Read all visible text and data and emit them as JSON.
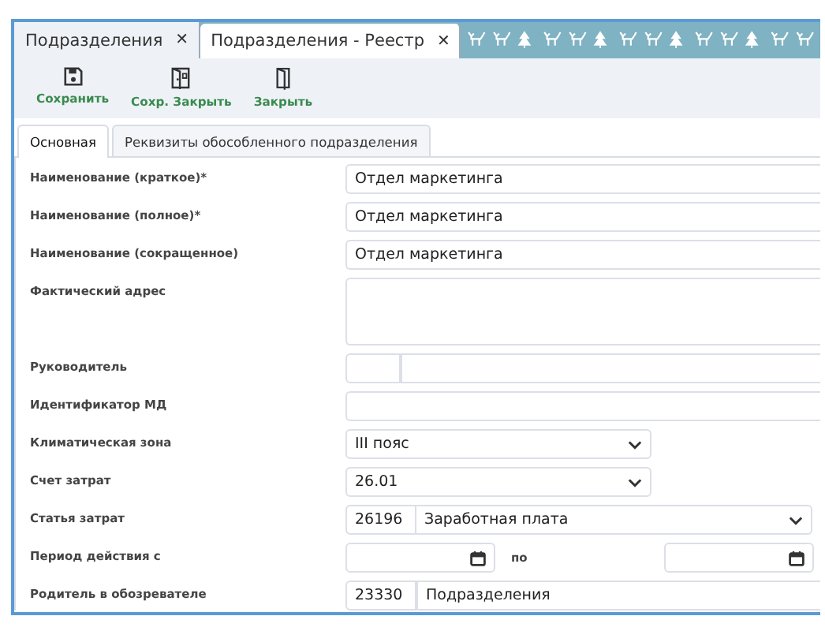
{
  "doc_tabs": [
    {
      "label": "Подразделения",
      "close": "✕",
      "selected": true
    },
    {
      "label": "Подразделения - Реестр",
      "close": "✕",
      "selected": false
    }
  ],
  "toolbar": [
    {
      "kind": "save",
      "label": "Сохранить"
    },
    {
      "kind": "save_close",
      "label": "Сохр. Закрыть"
    },
    {
      "kind": "close",
      "label": "Закрыть"
    }
  ],
  "form_tabs": [
    {
      "label": "Основная",
      "selected": true
    },
    {
      "label": "Реквизиты обособленного подразделения",
      "selected": false
    }
  ],
  "fields": [
    {
      "kind": "text",
      "label": "Наименование (краткое)*",
      "value": "Отдел маркетинга"
    },
    {
      "kind": "text",
      "label": "Наименование (полное)*",
      "value": "Отдел маркетинга"
    },
    {
      "kind": "text",
      "label": "Наименование (сокращенное)",
      "value": "Отдел маркетинга"
    },
    {
      "kind": "textarea",
      "label": "Фактический адрес"
    },
    {
      "kind": "lookup",
      "label": "Руководитель"
    },
    {
      "kind": "text",
      "label": "Идентификатор МД"
    },
    {
      "kind": "select",
      "label": "Климатическая зона",
      "value": "III пояс"
    },
    {
      "kind": "select",
      "label": "Счет затрат",
      "value": "26.01"
    },
    {
      "kind": "code_select",
      "label": "Статья затрат",
      "code": "26196",
      "value": "Заработная плата"
    },
    {
      "kind": "period",
      "label": "Период действия с",
      "to_label": "по"
    },
    {
      "kind": "lookup",
      "label": "Родитель в обозревателе",
      "code": "23330",
      "value": "Подразделения"
    }
  ]
}
